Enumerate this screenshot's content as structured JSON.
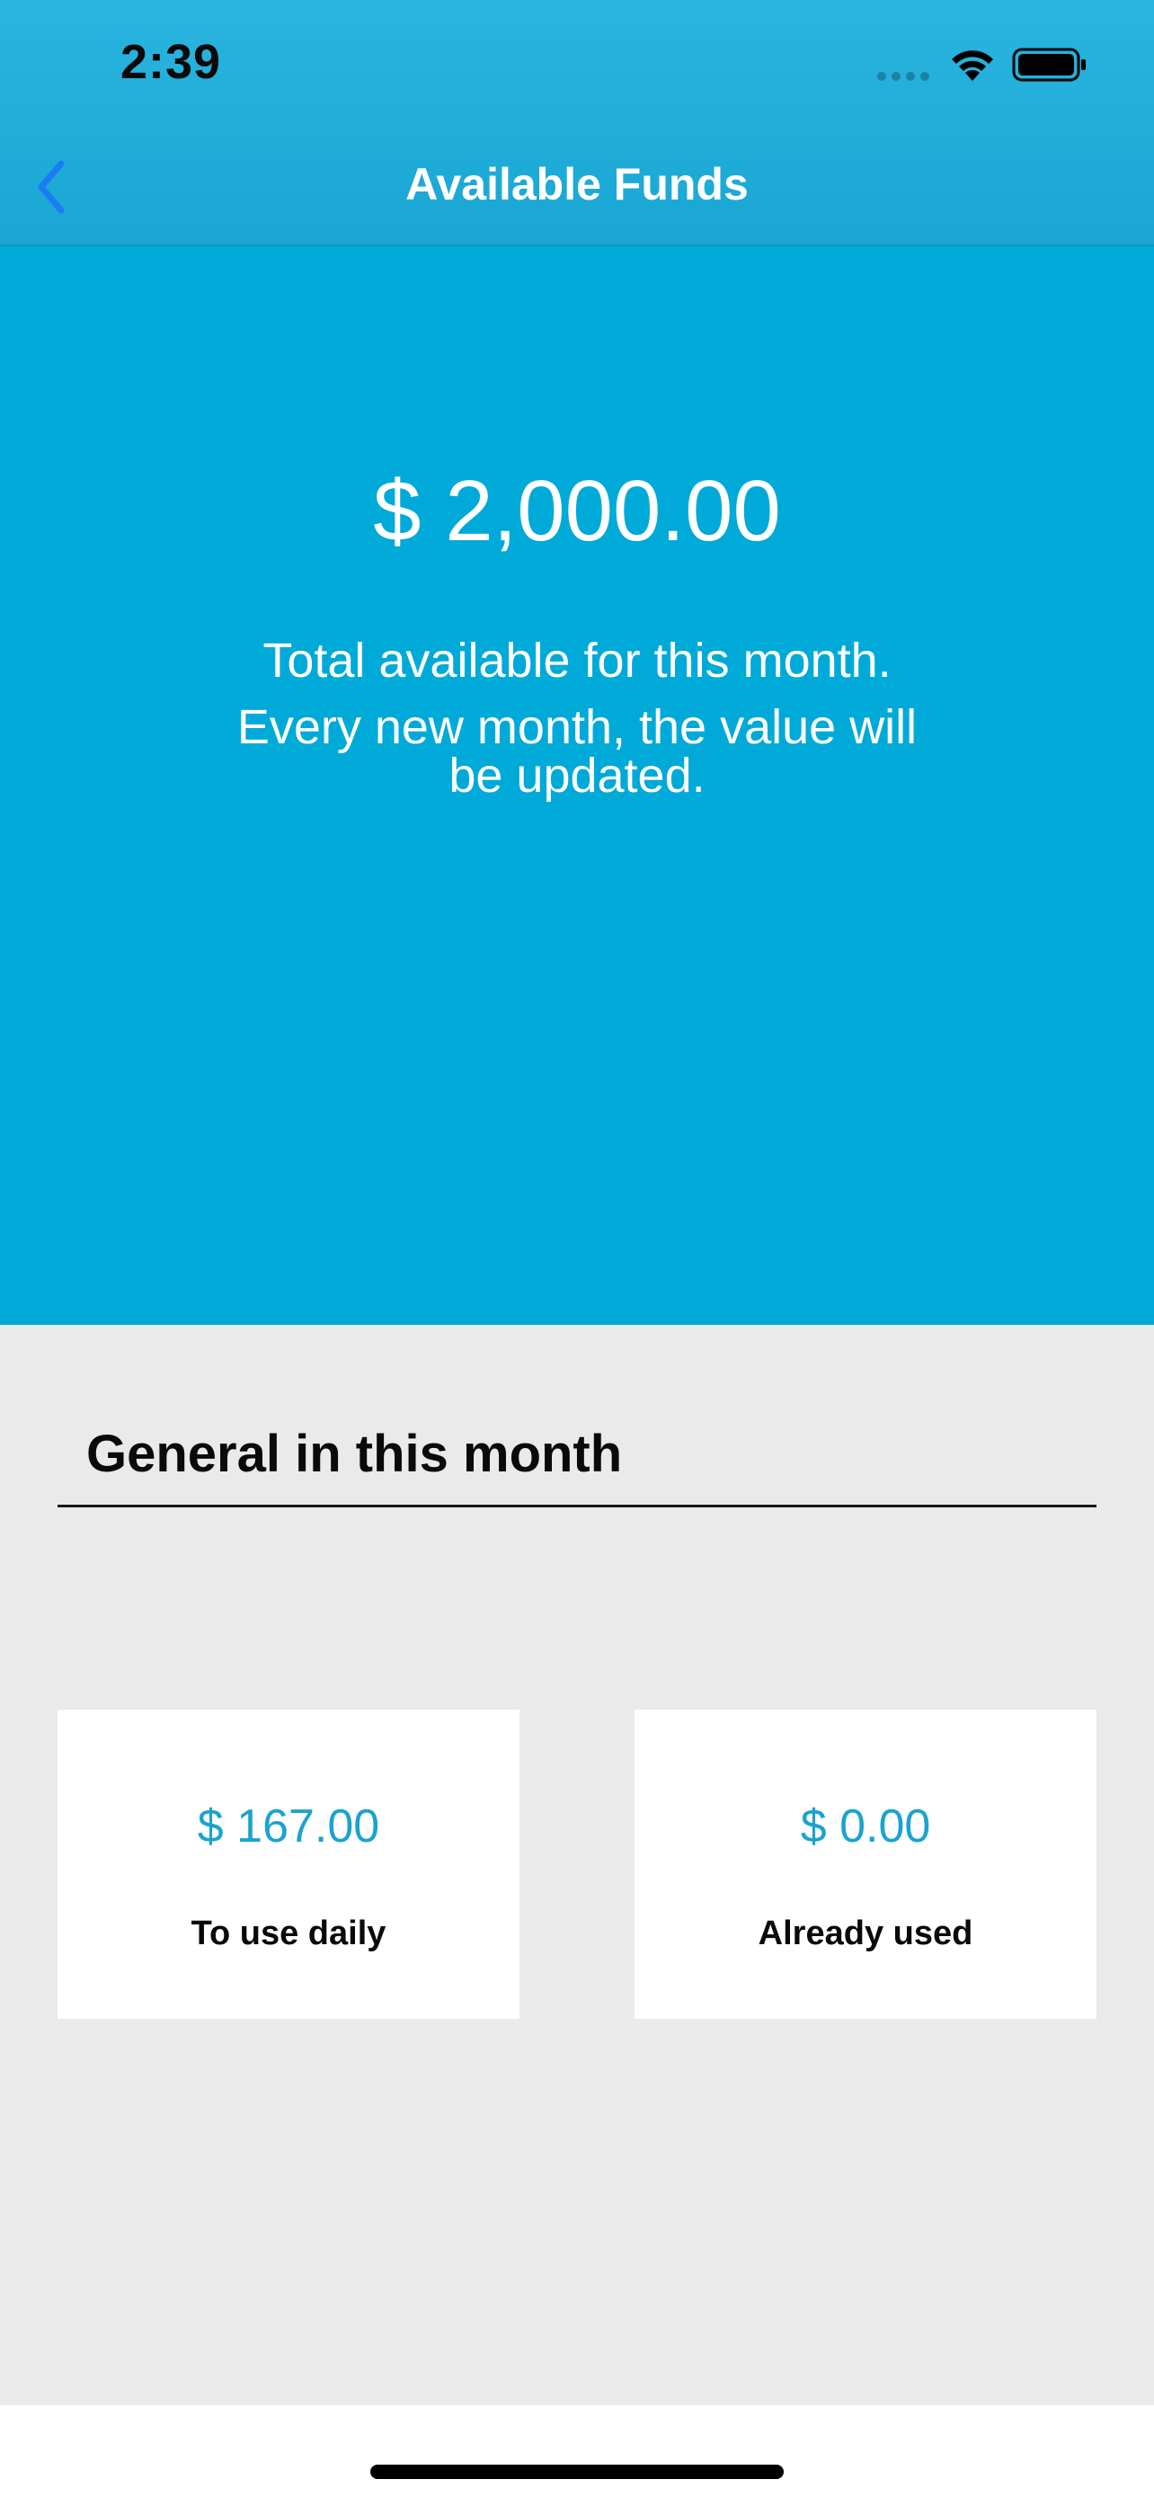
{
  "status_bar": {
    "time": "2:39",
    "icons": [
      "signal-icon",
      "wifi-icon",
      "battery-icon"
    ]
  },
  "nav": {
    "title": "Available Funds",
    "back_icon": "chevron-left-icon",
    "back_color": "#1a7cf5"
  },
  "hero": {
    "amount": "$ 2,000.00",
    "line1": "Total available for this month.",
    "line2": "Every new month, the value will be updated.",
    "background_color": "#00aad8"
  },
  "general": {
    "title": "General in this month",
    "cards": [
      {
        "value": "$ 167.00",
        "label": "To use daily"
      },
      {
        "value": "$ 0.00",
        "label": "Already used"
      }
    ],
    "value_color": "#1aa3cf"
  }
}
